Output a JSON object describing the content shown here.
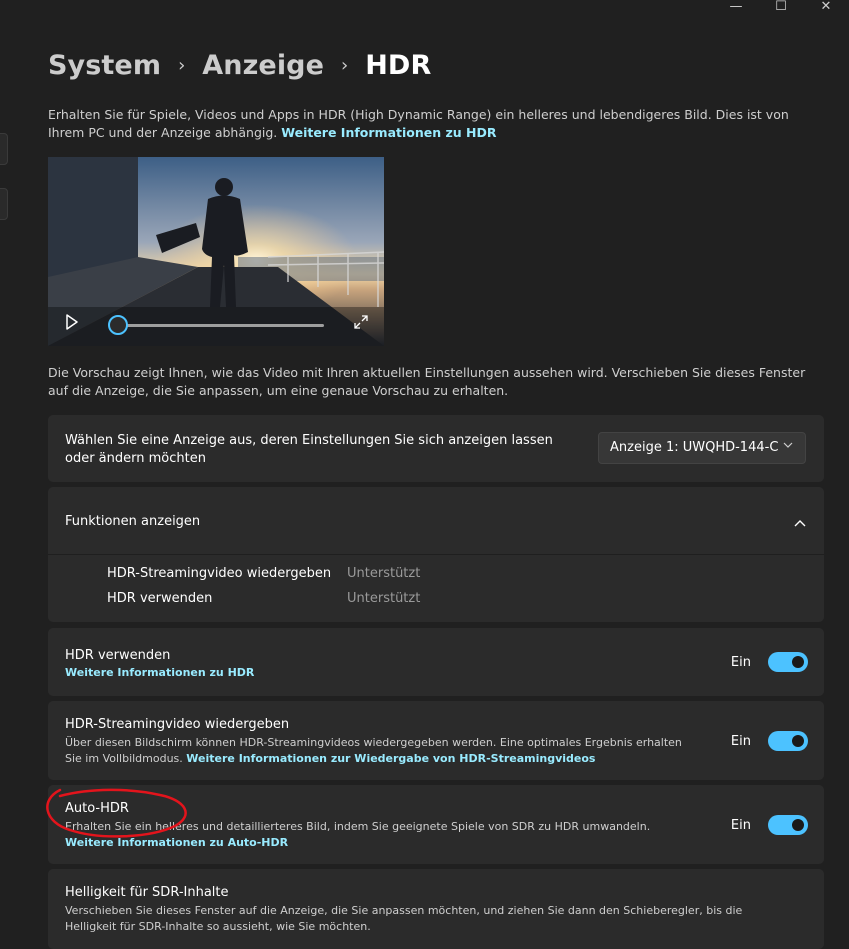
{
  "window": {
    "minimize_glyph": "—",
    "maximize_glyph": "☐",
    "close_glyph": "✕"
  },
  "breadcrumb": {
    "items": [
      "System",
      "Anzeige",
      "HDR"
    ],
    "separator": "›"
  },
  "intro": {
    "text": "Erhalten Sie für Spiele, Videos und Apps in HDR (High Dynamic Range) ein helleres und lebendigeres Bild. Dies ist von Ihrem PC und der Anzeige abhängig.",
    "link": "Weitere Informationen zu HDR"
  },
  "video": {
    "progress": 0.0,
    "play_icon": "play-icon",
    "fullscreen_icon": "expand-icon"
  },
  "preview_note": "Die Vorschau zeigt Ihnen, wie das Video mit Ihren aktuellen Einstellungen aussehen wird. Verschieben Sie dieses Fenster auf die Anzeige, die Sie anpassen, um eine genaue Vorschau zu erhalten.",
  "display_select": {
    "label": "Wählen Sie eine Anzeige aus, deren Einstellungen Sie sich anzeigen lassen oder ändern möchten",
    "value": "Anzeige 1: UWQHD-144-C"
  },
  "features": {
    "title": "Funktionen anzeigen",
    "rows": [
      {
        "name": "HDR-Streamingvideo wiedergeben",
        "status": "Unterstützt"
      },
      {
        "name": "HDR verwenden",
        "status": "Unterstützt"
      }
    ]
  },
  "settings": {
    "use_hdr": {
      "title": "HDR verwenden",
      "link": "Weitere Informationen zu HDR",
      "state": "Ein"
    },
    "streaming": {
      "title": "HDR-Streamingvideo wiedergeben",
      "desc": "Über diesen Bildschirm können HDR-Streamingvideos wiedergegeben werden. Eine optimales Ergebnis erhalten Sie im Vollbildmodus.",
      "link": "Weitere Informationen zur Wiedergabe von HDR-Streamingvideos",
      "state": "Ein"
    },
    "auto_hdr": {
      "title": "Auto-HDR",
      "desc": "Erhalten Sie ein helleres und detaillierteres Bild, indem Sie geeignete Spiele von SDR zu HDR umwandeln.",
      "link": "Weitere Informationen zu Auto-HDR",
      "state": "Ein"
    },
    "sdr_brightness": {
      "title": "Helligkeit für SDR-Inhalte",
      "desc": "Verschieben Sie dieses Fenster auf die Anzeige, die Sie anpassen möchten, und ziehen Sie dann den Schieberegler, bis die Helligkeit für SDR-Inhalte so aussieht, wie Sie möchten."
    }
  },
  "colors": {
    "accent": "#4cc2ff",
    "link": "#99ebff",
    "annotation": "#e3141c"
  }
}
